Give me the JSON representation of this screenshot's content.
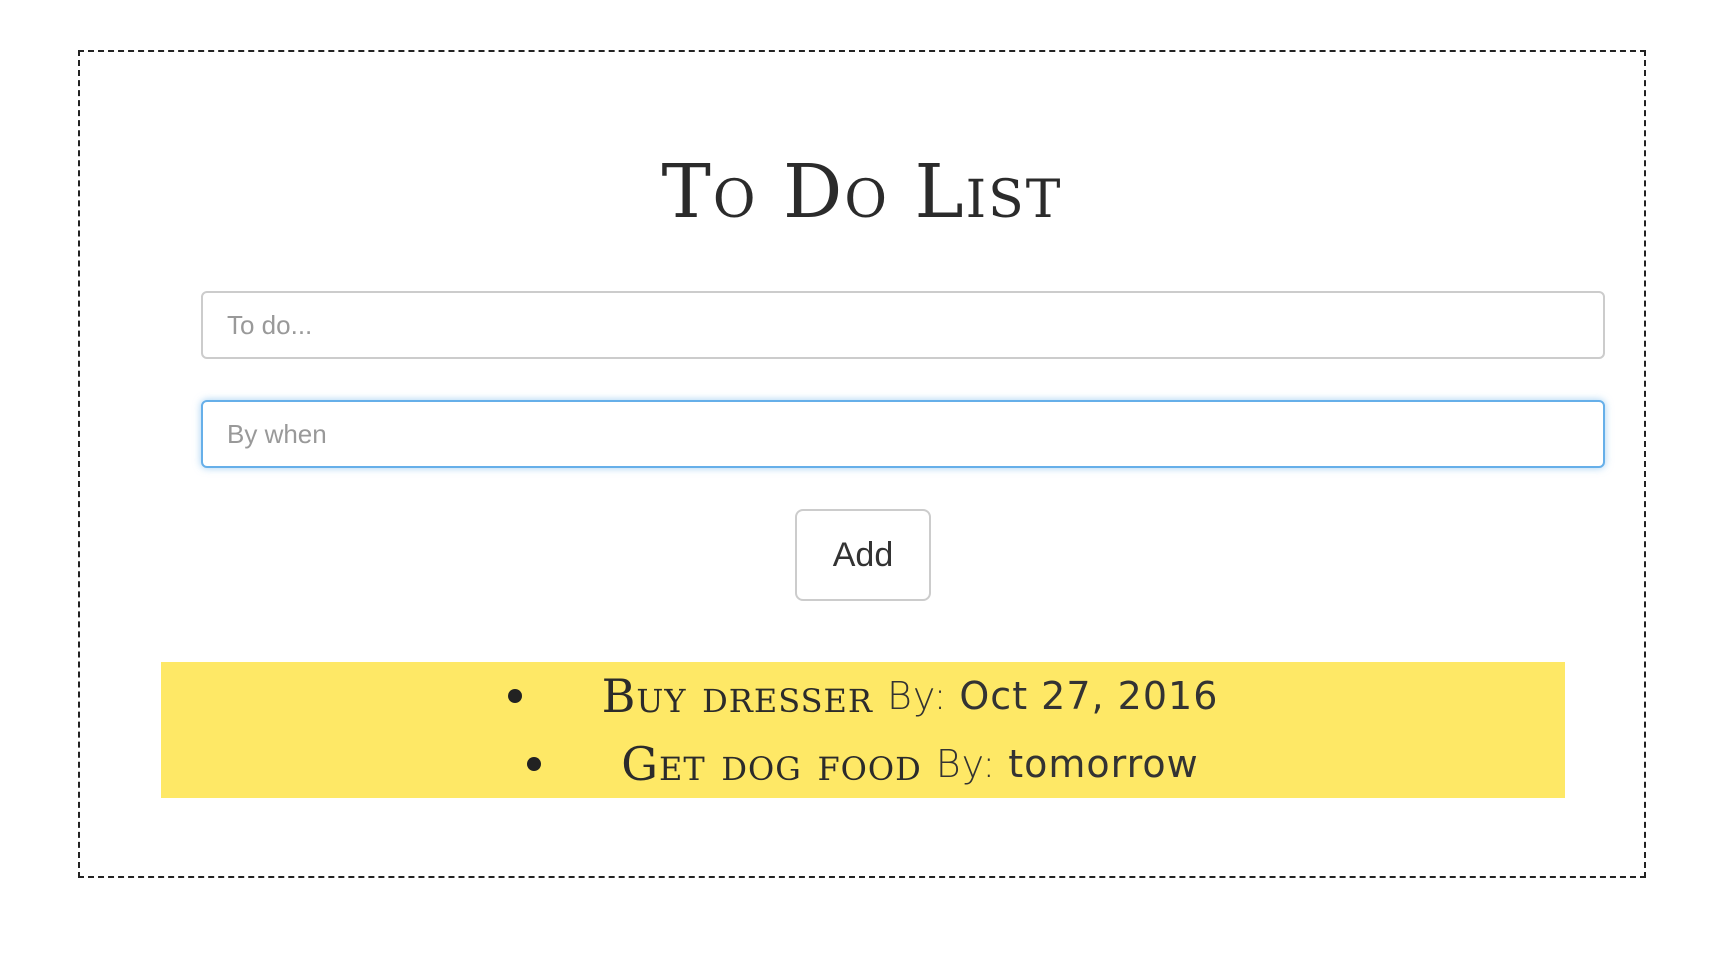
{
  "app": {
    "title": "To Do List"
  },
  "form": {
    "todo_placeholder": "To do...",
    "todo_value": "",
    "when_placeholder": "By when",
    "when_value": "",
    "add_label": "Add"
  },
  "todos": [
    {
      "text": "Buy dresser",
      "by_label": "By:",
      "date": "Oct 27, 2016"
    },
    {
      "text": "Get dog food",
      "by_label": "By:",
      "date": "tomorrow"
    }
  ],
  "colors": {
    "panel_background": "#fee866",
    "focus_border": "#66afe9"
  }
}
